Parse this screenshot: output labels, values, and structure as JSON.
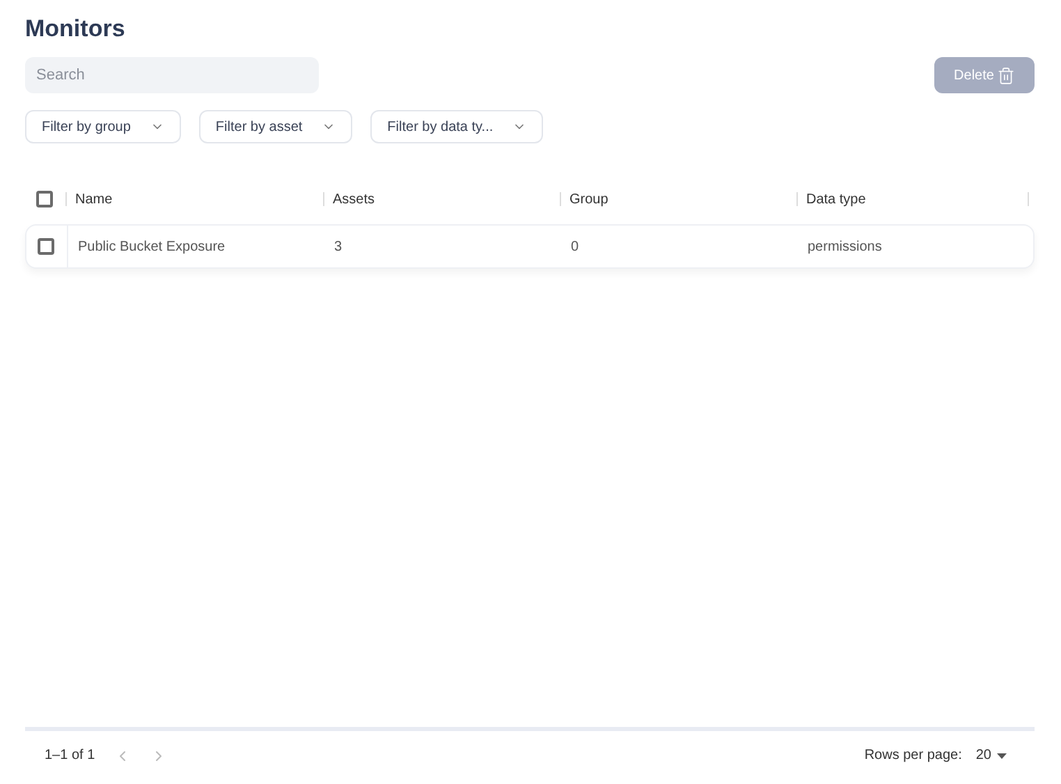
{
  "title": "Monitors",
  "search": {
    "placeholder": "Search"
  },
  "delete_button": {
    "label": "Delete",
    "disabled": true
  },
  "filters": [
    {
      "label": "Filter by group"
    },
    {
      "label": "Filter by asset"
    },
    {
      "label": "Filter by data ty..."
    }
  ],
  "table": {
    "select_all": {
      "checked": false
    },
    "columns": [
      "Name",
      "Assets",
      "Group",
      "Data type"
    ],
    "rows": [
      {
        "checked": false,
        "cells": [
          "Public Bucket Exposure",
          "3",
          "0",
          "permissions"
        ]
      }
    ]
  },
  "pagination": {
    "range": "1–1 of 1",
    "rows_per_page_label": "Rows per page:",
    "rows_per_page": "20"
  }
}
